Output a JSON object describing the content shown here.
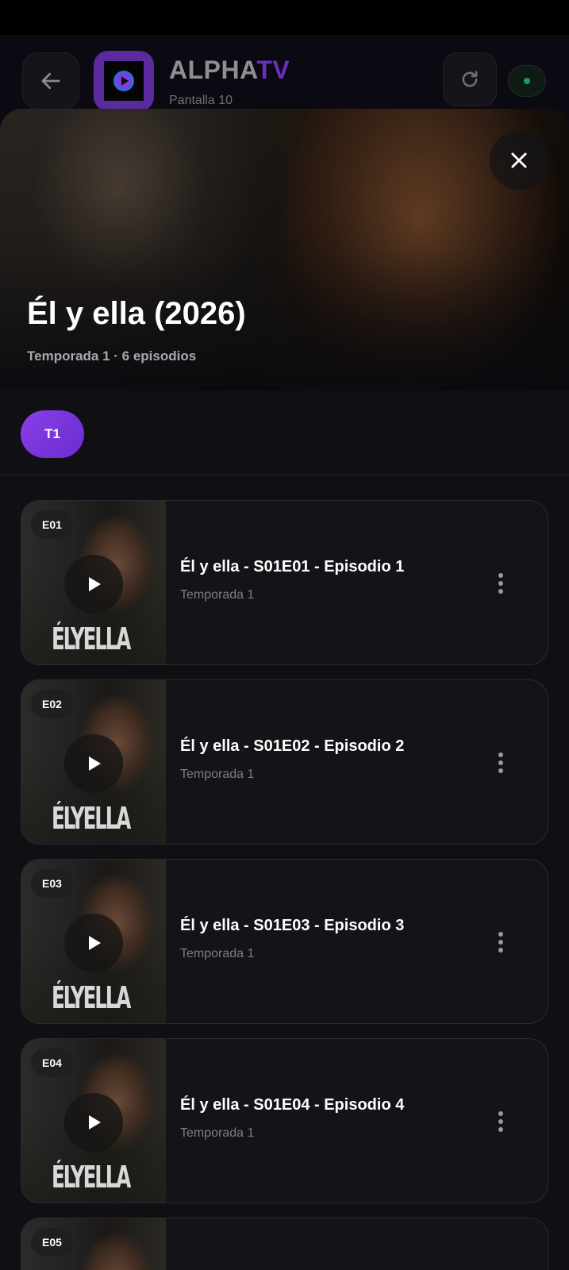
{
  "header": {
    "brand_main": "ALPHA",
    "brand_accent": "TV",
    "screen_label": "Pantalla 10",
    "status_color": "#1f9b55"
  },
  "modal": {
    "title": "Él y ella (2026)",
    "meta": "Temporada 1 · 6 episodios",
    "close_icon": "close-icon"
  },
  "seasons": [
    {
      "label": "T1",
      "selected": true
    }
  ],
  "episodes": [
    {
      "badge": "E01",
      "title": "Él y ella - S01E01 - Episodio 1",
      "season": "Temporada 1",
      "thumb_logo": "ÉLYELLA"
    },
    {
      "badge": "E02",
      "title": "Él y ella - S01E02 - Episodio 2",
      "season": "Temporada 1",
      "thumb_logo": "ÉLYELLA"
    },
    {
      "badge": "E03",
      "title": "Él y ella - S01E03 - Episodio 3",
      "season": "Temporada 1",
      "thumb_logo": "ÉLYELLA"
    },
    {
      "badge": "E04",
      "title": "Él y ella - S01E04 - Episodio 4",
      "season": "Temporada 1",
      "thumb_logo": "ÉLYELLA"
    },
    {
      "badge": "E05",
      "title": "",
      "season": "",
      "thumb_logo": ""
    }
  ],
  "colors": {
    "accent": "#7a35dd",
    "background": "#0f0f14",
    "card": "#141418"
  }
}
